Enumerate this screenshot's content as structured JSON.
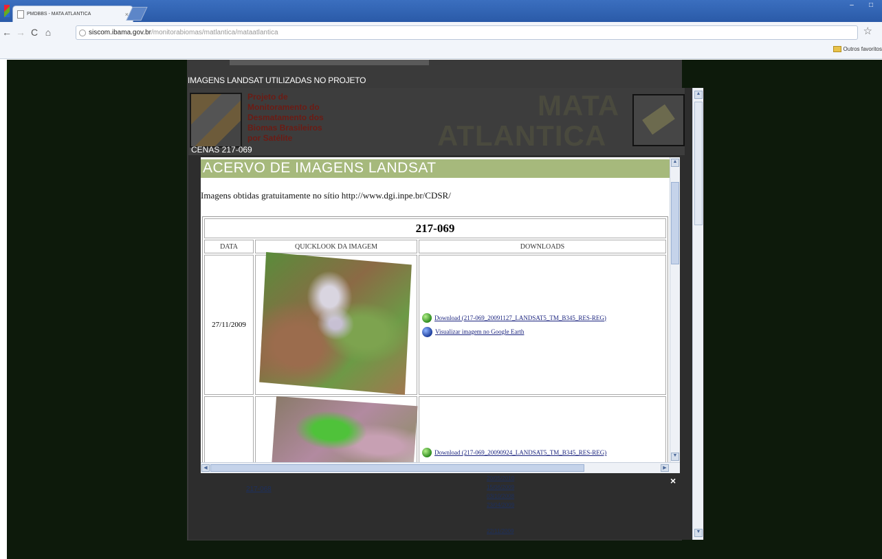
{
  "browser": {
    "tab_title": "PMDBBS - MATA ATLANTICA",
    "tab_close": "×",
    "url_host": "siscom.ibama.gov.br",
    "url_path": "/monitorabiomas/matlantica/mataatlantica",
    "star": "☆",
    "back": "←",
    "forward": "→",
    "reload": "C",
    "home": "⌂",
    "window_min": "–",
    "window_max": "□",
    "other_bookmarks": "Outros favoritos"
  },
  "lightbox": {
    "title": "IMAGENS LANDSAT UTILIZADAS NO PROJETO",
    "scene_label": "CENAS 217-069",
    "close": "×"
  },
  "banner": {
    "lines": [
      "Projeto de",
      "Monitoramento do",
      "Desmatamento dos",
      "Biomas Brasileiros",
      "por Satélite"
    ],
    "brand_top": "MATA",
    "brand_bottom": "ATLANTICA"
  },
  "acervo": {
    "header": "ACERVO DE IMAGENS LANDSAT",
    "intro": "Imagens obtidas gratuitamente no sítio http://www.dgi.inpe.br/CDSR/",
    "scene_id": "217-069",
    "columns": [
      "DATA",
      "QUICKLOOK DA IMAGEM",
      "DOWNLOADS"
    ],
    "rows": [
      {
        "date": "27/11/2009",
        "download_label": "Download (217-069_20091127_LANDSAT5_TM_B345_RES-REG)",
        "earth_label": "Visualizar imagem no Google Earth"
      },
      {
        "date": "",
        "download_label": "Download (217-069_20090924_LANDSAT5_TM_B345_RES-REG)"
      }
    ]
  },
  "background": {
    "link": "217-068",
    "dates": [
      "20/05/2010",
      "15/06/2009",
      "03/10/2008",
      "23/04/2009"
    ],
    "bottom_date": "22/11/2009"
  }
}
